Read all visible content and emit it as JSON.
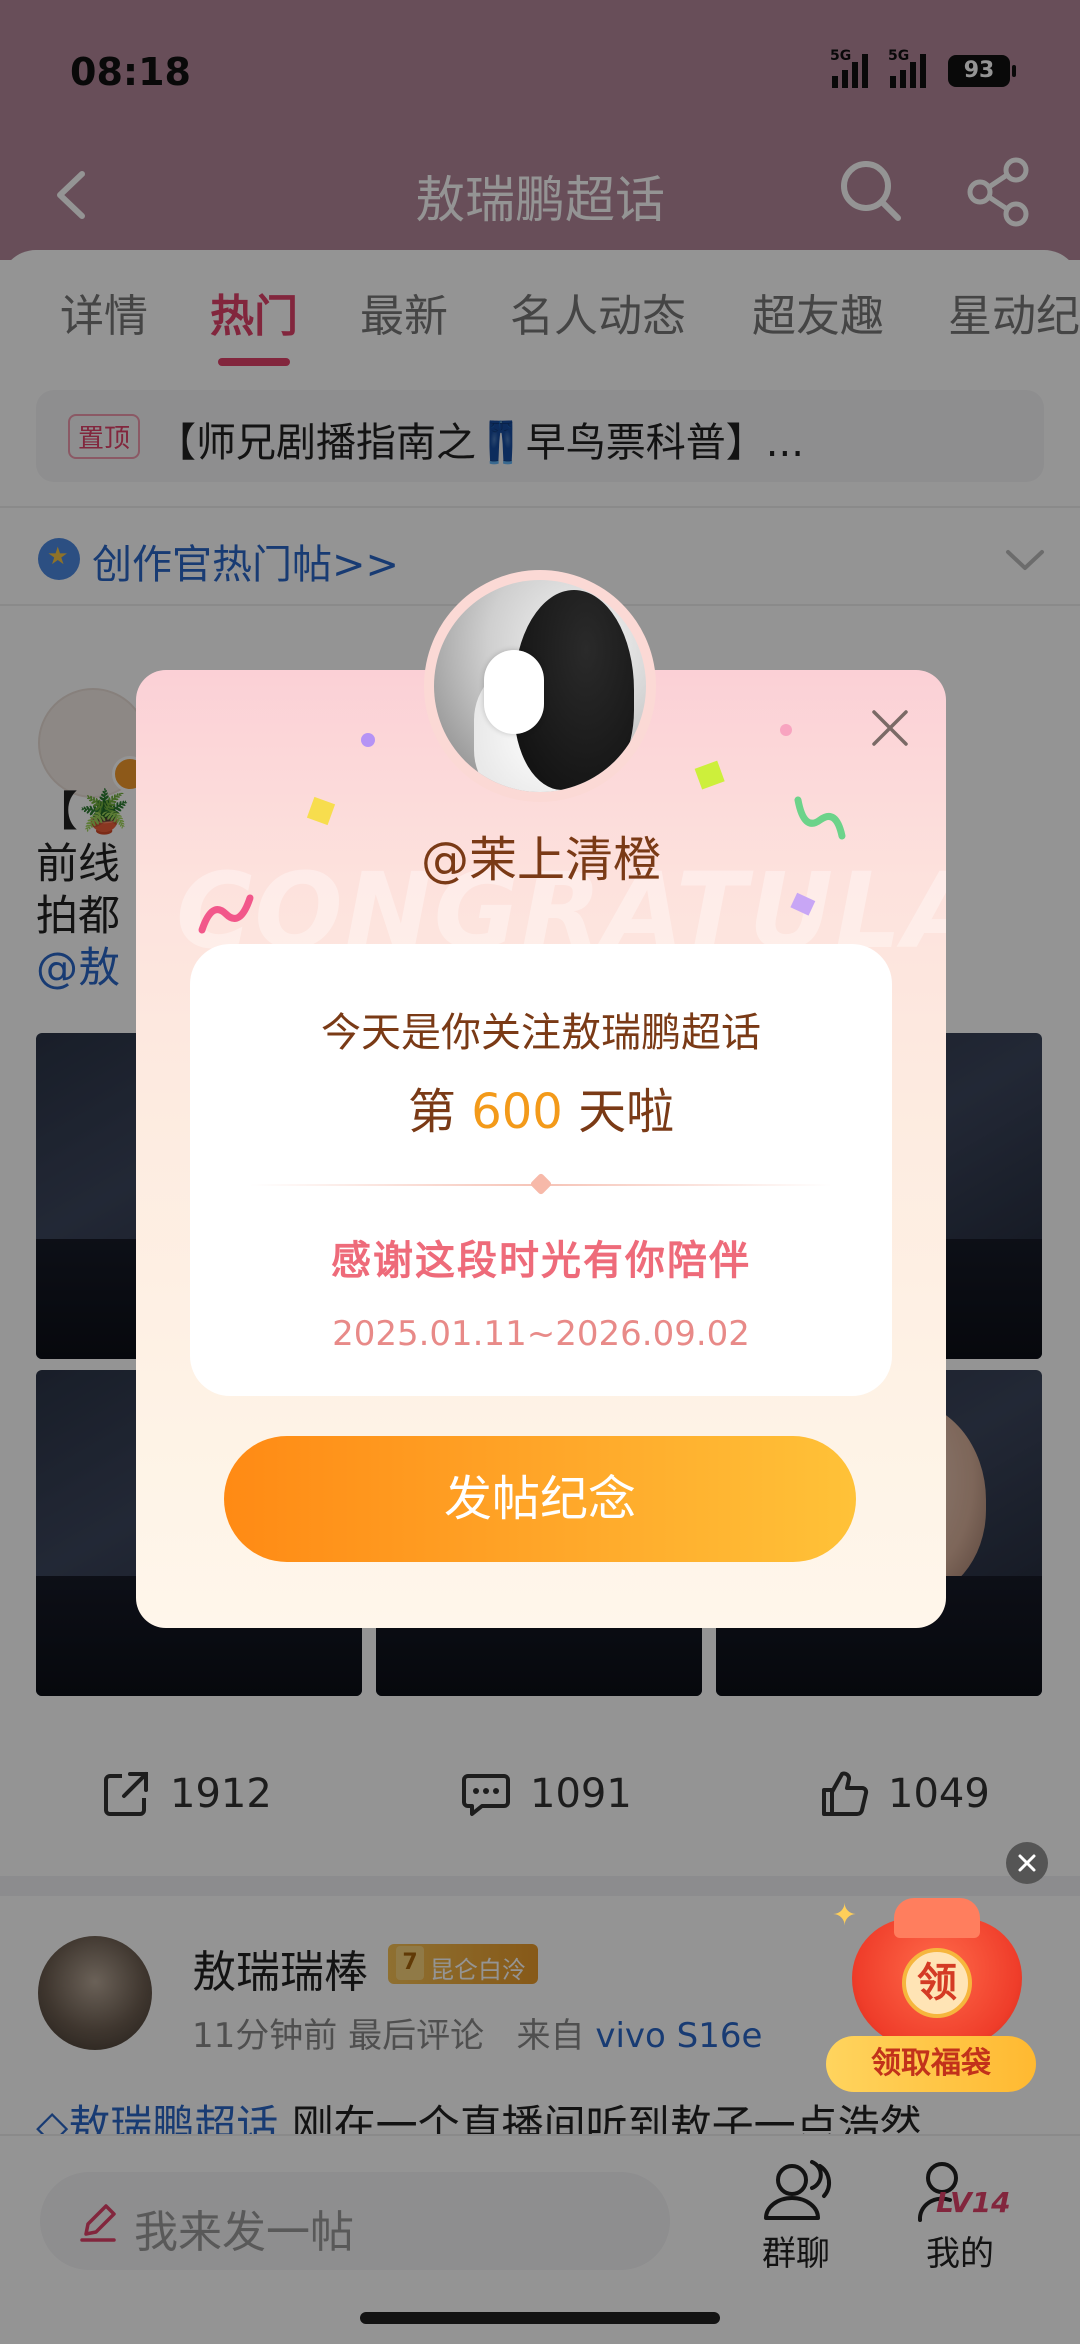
{
  "status_bar": {
    "time": "08:18",
    "signal1": "5G",
    "signal2": "5G",
    "battery": "93"
  },
  "nav": {
    "title": "敖瑞鹏超话"
  },
  "tabs": [
    {
      "label": "详情"
    },
    {
      "label": "热门"
    },
    {
      "label": "最新"
    },
    {
      "label": "名人动态"
    },
    {
      "label": "超友趣"
    },
    {
      "label": "星动纪"
    }
  ],
  "pinned": {
    "badge": "置顶",
    "text": "【师兄剧播指南之👖早鸟票科普】..."
  },
  "creator": {
    "text": "创作官热门帖>>"
  },
  "post1": {
    "text_line1": "【🪴",
    "text_line2": "前线",
    "text_line3": "拍都",
    "mention": "@敖",
    "share_count": "1912",
    "comment_count": "1091",
    "like_count": "1049"
  },
  "post2": {
    "username": "敖瑞瑞棒",
    "level_num": "7",
    "level_name": "昆仑白泠",
    "time": "11分钟前 最后评论",
    "source_prefix": "来自",
    "device": "vivo S16e",
    "topic": "◇敖瑞鹏超话",
    "content": " 刚在一个直播间听到敖子一点浩然"
  },
  "bottom_bar": {
    "compose_placeholder": "我来发一帖",
    "group_chat": "群聊",
    "mine": "我的",
    "level": "LV14"
  },
  "lucky_bag": {
    "seal": "领",
    "label": "领取福袋"
  },
  "modal": {
    "watermark": "CONGRATULATE",
    "user": "@茉上清橙",
    "line1": "今天是你关注敖瑞鹏超话",
    "line2_prefix": "第 ",
    "days": "600",
    "line2_suffix": " 天啦",
    "thanks": "感谢这段时光有你陪伴",
    "dates": "2025.01.11~2026.09.02",
    "button": "发帖纪念"
  },
  "colors": {
    "accent": "#e0426a",
    "link": "#2a66c7",
    "cta": "#ff9a1f",
    "nav_bg": "#b4879a"
  }
}
